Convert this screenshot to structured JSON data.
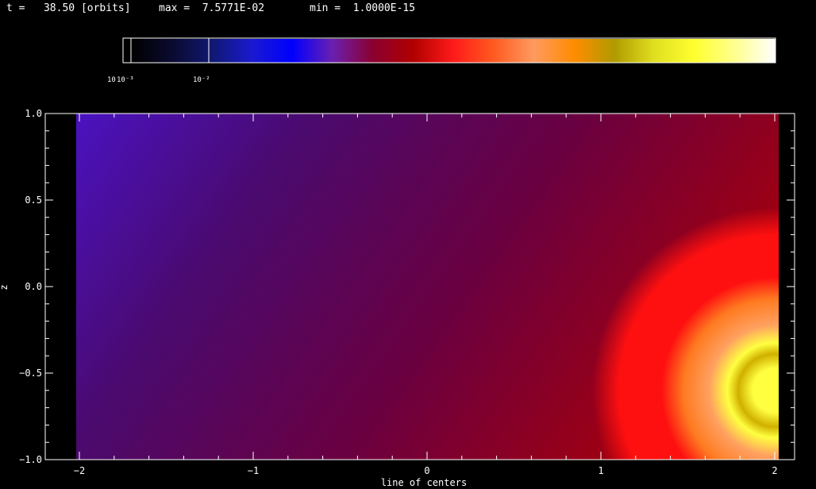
{
  "header": {
    "time_label": "t =",
    "time_value": "38.50",
    "time_unit": "[orbits]",
    "max_label": "max =",
    "max_value": "7.5771E-02",
    "min_label": "min =",
    "min_value": "1.0000E-15"
  },
  "colorbar": {
    "tick_labels": [
      "10",
      "10⁻³",
      "10⁻²"
    ],
    "colors": [
      "#000000",
      "#0a0a2e",
      "#101870",
      "#1a1acf",
      "#0000ff",
      "#6a1fb0",
      "#8b0030",
      "#b00000",
      "#ff1a1a",
      "#ff5a20",
      "#ff9a60",
      "#ff8c00",
      "#b09a00",
      "#e0e020",
      "#ffff30",
      "#ffff90",
      "#ffffff"
    ]
  },
  "chart_data": {
    "type": "heatmap",
    "title": "",
    "xlabel": "line of centers",
    "ylabel": "z",
    "xlim": [
      -2,
      2
    ],
    "ylim": [
      -1.0,
      1.0
    ],
    "x_ticks": [
      -2,
      -1,
      0,
      1,
      2
    ],
    "x_tick_labels": [
      "−2",
      "−1",
      "0",
      "1",
      "2"
    ],
    "y_ticks": [
      -1.0,
      -0.5,
      0.0,
      0.5,
      1.0
    ],
    "y_tick_labels": [
      "−1.0",
      "−0.5",
      "0.0",
      "0.5",
      "1.0"
    ],
    "grid": false,
    "hot_spot": {
      "x": 2.0,
      "z": -0.6
    },
    "field_colors": [
      "#4a12c0",
      "#4a0a6e",
      "#6a0040",
      "#a00010",
      "#ff1010",
      "#ff7a20",
      "#ffa060",
      "#d0b000",
      "#ffff40"
    ]
  }
}
